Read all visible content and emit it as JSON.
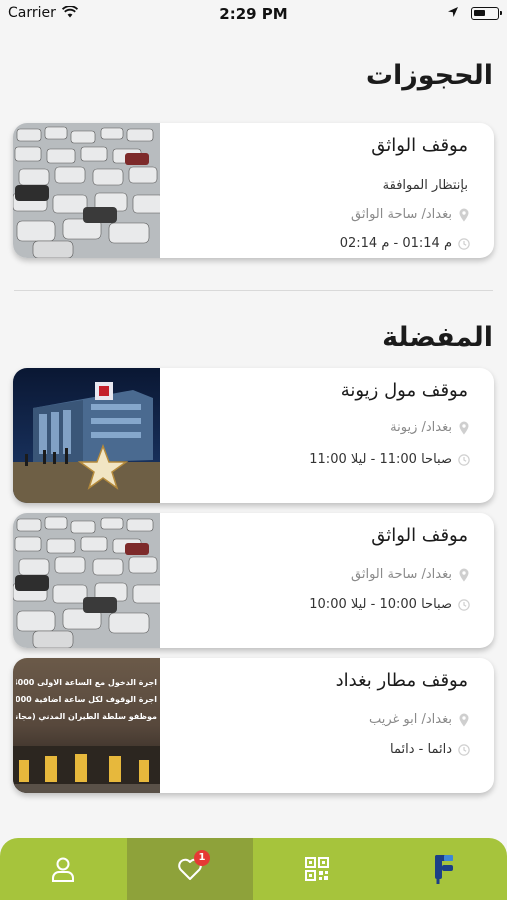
{
  "status_bar": {
    "carrier": "Carrier",
    "time": "2:29 PM"
  },
  "bookings": {
    "title": "الحجوزات",
    "items": [
      {
        "name": "موقف الواثق",
        "status": "بإنتظار الموافقة",
        "location": "بغداد/ ساحة الواثق",
        "time": "م 01:14 - م 02:14"
      }
    ]
  },
  "favorites": {
    "title": "المفضلة",
    "items": [
      {
        "name": "موقف مول زيونة",
        "location": "بغداد/ زيونة",
        "time": "صباحا 11:00 - ليلا 11:00"
      },
      {
        "name": "موقف الواثق",
        "location": "بغداد/ ساحة الواثق",
        "time": "صباحا 10:00 - ليلا 10:00"
      },
      {
        "name": "موقف مطار بغداد",
        "location": "بغداد/ ابو غريب",
        "time": "دائما - دائما"
      }
    ]
  },
  "airport_sign": {
    "line1": "اجرة الدخول مع الساعة الاولى 4000 دينار",
    "line2": "اجرة الوقوف لكل ساعة اضافية 1000 دينار",
    "line3": "موظفو سلطة الطيران المدني (مجانا)"
  },
  "tabbar": {
    "favorites_badge": "1",
    "icons": [
      "profile-icon",
      "heart-icon",
      "qr-code-icon",
      "app-logo-icon"
    ],
    "colors": {
      "bar": "#a6c43c",
      "active": "#8ea23a",
      "badge": "#e53935"
    }
  }
}
